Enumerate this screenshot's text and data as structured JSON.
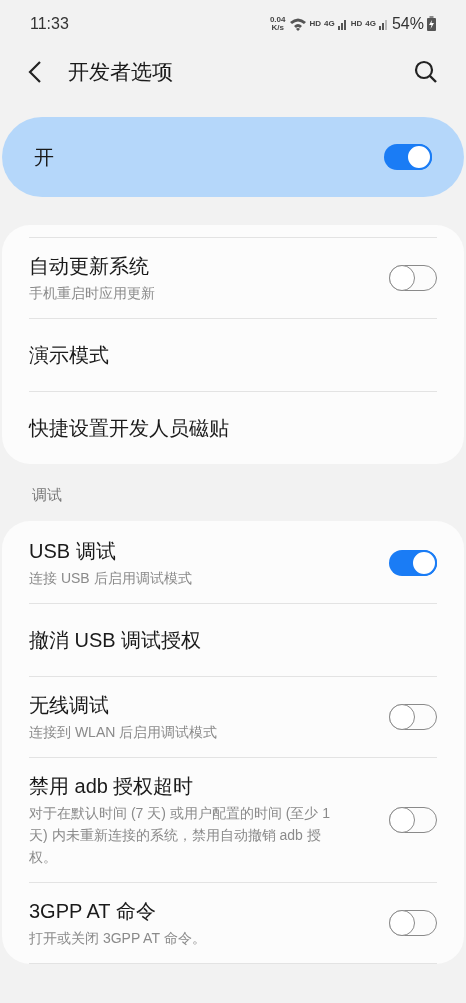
{
  "status_bar": {
    "time": "11:33",
    "speed_value": "0.04",
    "speed_unit": "K/s",
    "hd_1": "HD",
    "network_1": "4G",
    "hd_2": "HD",
    "network_2": "4G",
    "battery": "54%"
  },
  "header": {
    "title": "开发者选项"
  },
  "master_switch": {
    "label": "开",
    "on": true
  },
  "groups": [
    {
      "items": [
        {
          "title": "自动更新系统",
          "subtitle": "手机重启时应用更新",
          "kind": "switch",
          "on": false
        },
        {
          "title": "演示模式",
          "kind": "plain"
        },
        {
          "title": "快捷设置开发人员磁贴",
          "kind": "plain"
        }
      ]
    },
    {
      "heading": "调试",
      "items": [
        {
          "title": "USB 调试",
          "subtitle": "连接 USB 后启用调试模式",
          "kind": "switch",
          "on": true
        },
        {
          "title": "撤消 USB 调试授权",
          "kind": "plain"
        },
        {
          "title": "无线调试",
          "subtitle": "连接到 WLAN 后启用调试模式",
          "kind": "switch",
          "on": false
        },
        {
          "title": "禁用 adb 授权超时",
          "subtitle": "对于在默认时间 (7 天) 或用户配置的时间 (至少 1 天) 内未重新连接的系统，禁用自动撤销 adb 授权。",
          "kind": "switch",
          "on": false
        },
        {
          "title": "3GPP AT 命令",
          "subtitle": "打开或关闭 3GPP AT 命令。",
          "kind": "switch",
          "on": false
        }
      ]
    }
  ]
}
